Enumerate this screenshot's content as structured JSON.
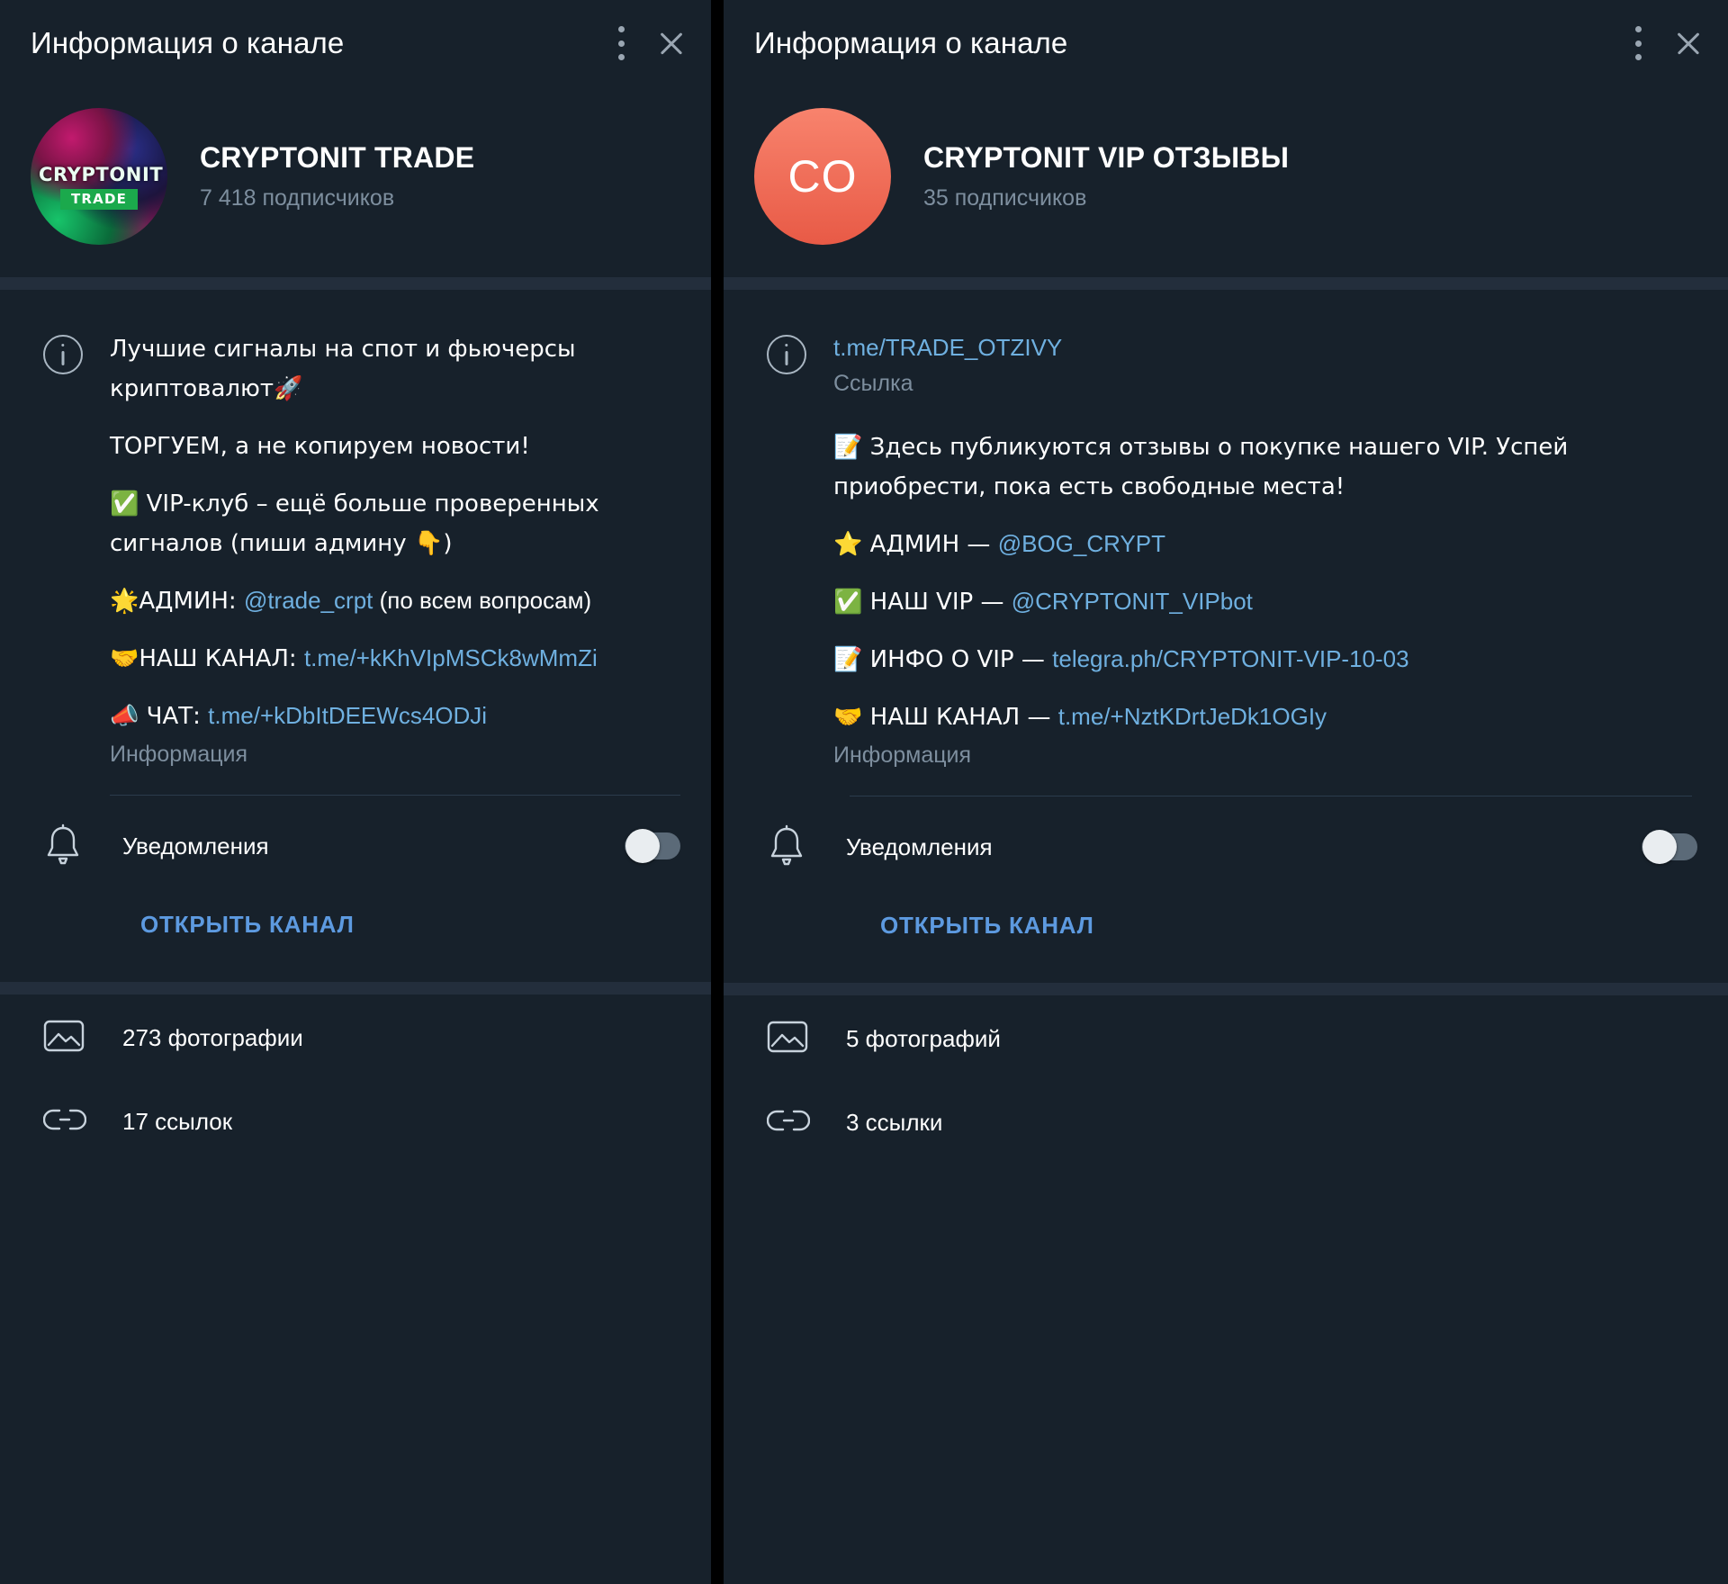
{
  "colors": {
    "panel_bg": "#17212b",
    "band": "#232e3c",
    "link": "#6fb0e0",
    "accent_action": "#5d9ae0",
    "muted": "#7d8e9e",
    "avatar_right": "#ef6a52"
  },
  "left_panel": {
    "header": {
      "title": "Информация о канале",
      "menu_icon": "more-vertical-icon",
      "close_icon": "close-icon"
    },
    "profile": {
      "avatar_type": "image",
      "avatar_text_line1": "CRYPTONIT",
      "avatar_text_line2": "TRADE",
      "name": "CRYPTONIT TRADE",
      "subscribers": "7 418 подписчиков"
    },
    "about": {
      "icon": "info-icon",
      "label": "Информация",
      "lines": [
        {
          "type": "text",
          "text": "Лучшие сигналы на спот и фьючерсы криптовалют🚀"
        },
        {
          "type": "blank"
        },
        {
          "type": "text",
          "text": "ТОРГУЕМ, а не копируем новости!"
        },
        {
          "type": "blank"
        },
        {
          "type": "text",
          "text": "✅ VIP-клуб – ещё больше проверенных сигналов (пиши админу 👇)"
        },
        {
          "type": "blank"
        },
        {
          "type": "mixed",
          "pre": "🌟АДМИН: ",
          "link": "@trade_crpt",
          "post": " (по всем вопросам)"
        },
        {
          "type": "blank"
        },
        {
          "type": "mixed",
          "pre": "🤝НАШ КАНАЛ: ",
          "link": "t.me/+kKhVIpMSCk8wMmZi",
          "post": ""
        },
        {
          "type": "blank"
        },
        {
          "type": "mixed",
          "pre": "📣 ЧАТ: ",
          "link": "t.me/+kDbItDEEWcs4ODJi",
          "post": ""
        }
      ]
    },
    "notifications": {
      "icon": "bell-icon",
      "label": "Уведомления",
      "toggle_state": "off"
    },
    "open_channel_label": "ОТКРЫТЬ КАНАЛ",
    "media": [
      {
        "icon": "photo-icon",
        "label": "273 фотографии"
      },
      {
        "icon": "link-icon",
        "label": "17 ссылок"
      }
    ]
  },
  "right_panel": {
    "header": {
      "title": "Информация о канале",
      "menu_icon": "more-vertical-icon",
      "close_icon": "close-icon"
    },
    "profile": {
      "avatar_type": "initials",
      "avatar_initials": "CO",
      "name": "CRYPTONIT VIP ОТЗЫВЫ",
      "subscribers": "35 подписчиков"
    },
    "about": {
      "icon": "info-icon",
      "primary_link": "t.me/TRADE_OTZIVY",
      "primary_link_label": "Ссылка",
      "label": "Информация",
      "lines": [
        {
          "type": "text",
          "text": "📝 Здесь публикуются отзывы о покупке нашего VIP. Успей приобрести, пока есть свободные места!"
        },
        {
          "type": "blank"
        },
        {
          "type": "mixed",
          "pre": "⭐ АДМИН — ",
          "link": "@BOG_CRYPT",
          "post": ""
        },
        {
          "type": "blank"
        },
        {
          "type": "mixed",
          "pre": "✅ НАШ VIP — ",
          "link": "@CRYPTONIT_VIPbot",
          "post": ""
        },
        {
          "type": "blank"
        },
        {
          "type": "mixed",
          "pre": "📝 ИНФО О VIP — ",
          "link": "telegra.ph/CRYPTONIT-VIP-10-03",
          "post": ""
        },
        {
          "type": "blank"
        },
        {
          "type": "mixed",
          "pre": "🤝 НАШ КАНАЛ — ",
          "link": "t.me/+NztKDrtJeDk1OGIy",
          "post": ""
        }
      ]
    },
    "notifications": {
      "icon": "bell-icon",
      "label": "Уведомления",
      "toggle_state": "off"
    },
    "open_channel_label": "ОТКРЫТЬ КАНАЛ",
    "media": [
      {
        "icon": "photo-icon",
        "label": "5 фотографий"
      },
      {
        "icon": "link-icon",
        "label": "3 ссылки"
      }
    ]
  }
}
